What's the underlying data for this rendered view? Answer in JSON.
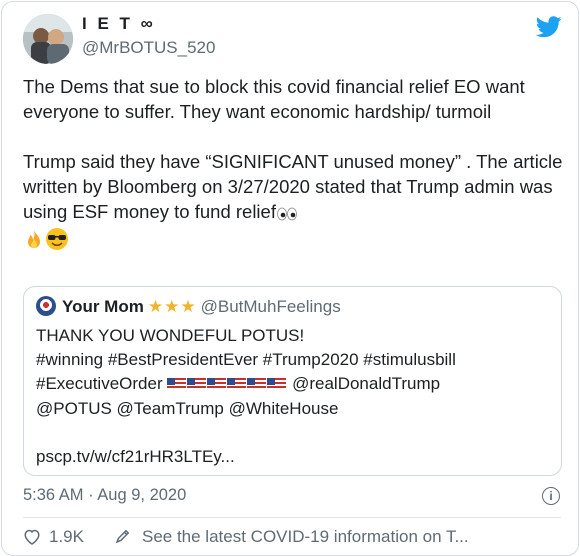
{
  "tweet": {
    "display_name": "I E T ∞",
    "handle": "@MrBOTUS_520",
    "paragraph1": "The Dems that sue to block this covid financial relief EO want everyone to suffer. They want economic hardship/ turmoil",
    "paragraph2": "Trump said they have “SIGNIFICANT unused money” . The article written by Bloomberg on 3/27/2020 stated that Trump admin was using ESF money to fund relief",
    "timestamp": "5:36 AM · Aug 9, 2020",
    "likes": "1.9K",
    "covid_link": "See the latest COVID-19 information on T..."
  },
  "quote": {
    "display_name": "Your Mom",
    "stars": "★★★",
    "handle": "@ButMuhFeelings",
    "line1": "THANK YOU WONDEFUL POTUS!",
    "line2": "#winning #BestPresidentEver #Trump2020 #stimulusbill",
    "line3_text": "#ExecutiveOrder",
    "line3_mention": "@realDonaldTrump",
    "line4": "@POTUS @TeamTrump @WhiteHouse",
    "link": "pscp.tv/w/cf21rHR3LTEy..."
  },
  "icons": {
    "brand": "twitter-bird-icon",
    "info": "info-icon",
    "like": "heart-icon",
    "share": "share-icon"
  },
  "colors": {
    "twitter_blue": "#1da1f2",
    "text": "#1c2023",
    "secondary": "#5f6b74",
    "border": "#d5dbe0"
  }
}
